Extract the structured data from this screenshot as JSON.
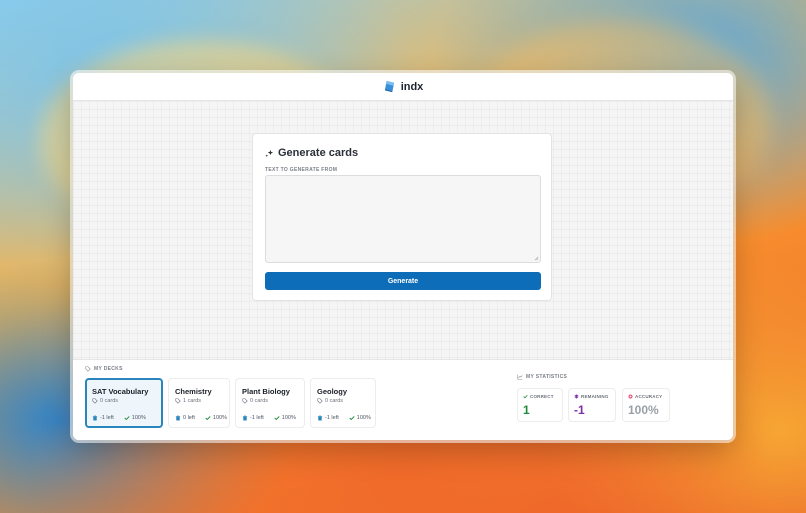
{
  "app": {
    "title": "indx"
  },
  "generator": {
    "title": "Generate cards",
    "field_label": "TEXT TO GENERATE FROM",
    "textarea_value": "",
    "button_label": "Generate"
  },
  "decks": {
    "section_label": "MY DECKS",
    "items": [
      {
        "name": "SAT Vocabulary",
        "count": "0 cards",
        "left": "-1 left",
        "accuracy": "100%"
      },
      {
        "name": "Chemistry",
        "count": "1 cards",
        "left": "0 left",
        "accuracy": "100%"
      },
      {
        "name": "Plant Biology",
        "count": "0 cards",
        "left": "-1 left",
        "accuracy": "100%"
      },
      {
        "name": "Geology",
        "count": "0 cards",
        "left": "-1 left",
        "accuracy": "100%"
      }
    ]
  },
  "statistics": {
    "section_label": "MY STATISTICS",
    "items": [
      {
        "label": "CORRECT",
        "value": "1",
        "color": "#1f8a3a"
      },
      {
        "label": "REMAINING",
        "value": "-1",
        "color": "#7b2fa8"
      },
      {
        "label": "ACCURACY",
        "value": "100%",
        "color": "#9aa0a8"
      }
    ]
  },
  "colors": {
    "accent": "#0e6db8",
    "active_deck_border": "#2b85bd"
  }
}
